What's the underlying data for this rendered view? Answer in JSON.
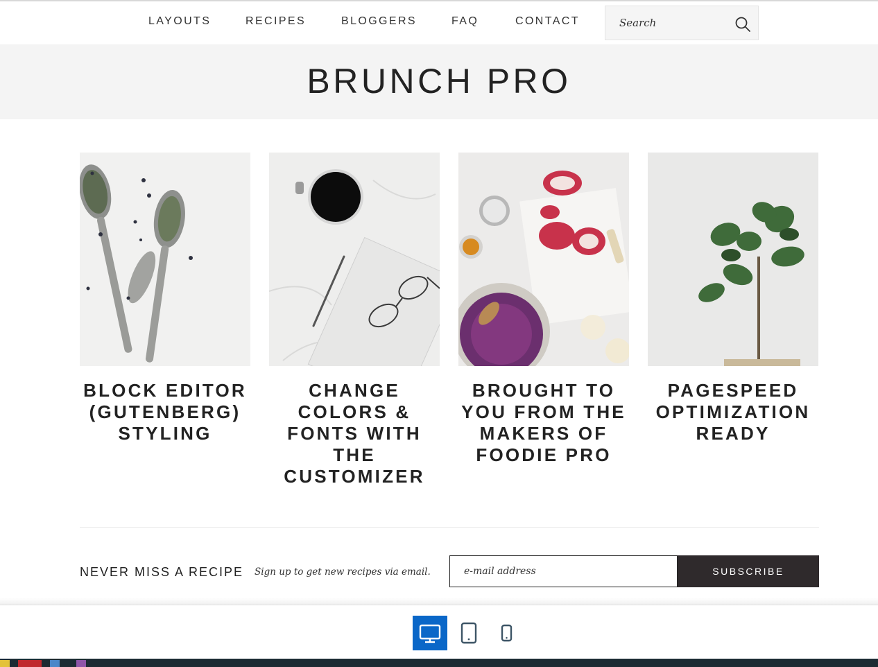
{
  "nav": {
    "items": [
      "LAYOUTS",
      "RECIPES",
      "BLOGGERS",
      "FAQ",
      "CONTACT"
    ],
    "search_placeholder": "Search"
  },
  "hero": {
    "title": "BRUNCH PRO"
  },
  "features": [
    {
      "title": "BLOCK EDITOR (GUTENBERG) STYLING"
    },
    {
      "title": "CHANGE COLORS & FONTS WITH THE CUSTOMIZER"
    },
    {
      "title": "BROUGHT TO YOU FROM THE MAKERS OF FOODIE PRO"
    },
    {
      "title": "PAGESPEED OPTIMIZATION READY"
    }
  ],
  "newsletter": {
    "heading": "NEVER MISS A RECIPE",
    "subtext": "Sign up to get new recipes via email.",
    "email_placeholder": "e-mail address",
    "button_label": "SUBSCRIBE"
  },
  "device_preview": {
    "options": [
      "desktop",
      "tablet",
      "mobile"
    ],
    "active": "desktop",
    "accent_color": "#0a67c8"
  }
}
